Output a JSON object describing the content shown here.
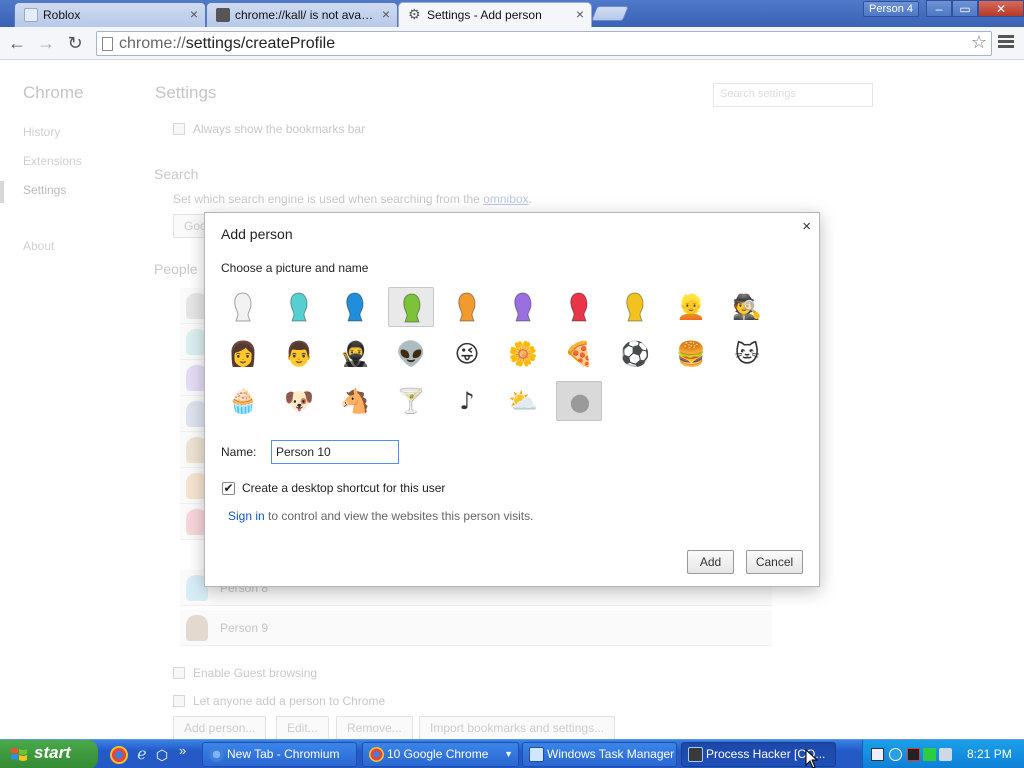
{
  "browser": {
    "tabs": [
      {
        "title": "Roblox",
        "icon": "page-icon",
        "close": "×"
      },
      {
        "title": "chrome://kall/ is not available",
        "icon": "page-icon",
        "close": "×"
      },
      {
        "title": "Settings - Add person",
        "icon": "gear-icon",
        "close": "×"
      }
    ],
    "profile_badge": "Person 4",
    "window_controls": {
      "minimize": "–",
      "maximize": "▭",
      "close": "✕"
    },
    "nav": {
      "back": "←",
      "forward": "→",
      "reload": "↻",
      "star": "☆"
    },
    "omnibox": {
      "scheme": "chrome://",
      "path": "settings/createProfile"
    }
  },
  "settings_page": {
    "nav_title": "Chrome",
    "nav_items": [
      "History",
      "Extensions",
      "Settings",
      "About"
    ],
    "title": "Settings",
    "search_placeholder": "Search settings",
    "bookmarks_bar_label": "Always show the bookmarks bar",
    "search_heading": "Search",
    "search_text": "Set which search engine is used when searching from the",
    "search_link": "omnibox",
    "search_engine_button": "Google",
    "people_heading": "People",
    "people_visible": [
      "Person 8",
      "Person 9"
    ],
    "guest_label": "Enable Guest browsing",
    "anyone_add_label": "Let anyone add a person to Chrome",
    "buttons": [
      "Add person...",
      "Edit...",
      "Remove...",
      "Import bookmarks and settings..."
    ]
  },
  "dialog": {
    "title": "Add person",
    "close": "×",
    "subtitle": "Choose a picture and name",
    "selected_avatar_index": 3,
    "avatars": [
      {
        "name": "white-person-avatar",
        "color": "#f2f2f2"
      },
      {
        "name": "teal-person-avatar",
        "color": "#55d0d0"
      },
      {
        "name": "blue-person-avatar",
        "color": "#1f8fdc"
      },
      {
        "name": "green-person-avatar",
        "color": "#7cc23a"
      },
      {
        "name": "orange-person-avatar",
        "color": "#f29a2e"
      },
      {
        "name": "purple-person-avatar",
        "color": "#9a6fe0"
      },
      {
        "name": "red-person-avatar",
        "color": "#e8354a"
      },
      {
        "name": "yellow-person-avatar",
        "color": "#f2c31e"
      },
      {
        "name": "businessman-avatar",
        "glyph": "👱"
      },
      {
        "name": "ninja-man-avatar",
        "glyph": "🕵"
      },
      {
        "name": "woman-sunglasses-avatar",
        "glyph": "👩"
      },
      {
        "name": "man-avatar",
        "glyph": "👨"
      },
      {
        "name": "ninja-avatar",
        "glyph": "🥷"
      },
      {
        "name": "alien-avatar",
        "glyph": "👽"
      },
      {
        "name": "smiley-avatar",
        "glyph": "😜"
      },
      {
        "name": "flower-avatar",
        "glyph": "🌼"
      },
      {
        "name": "pizza-avatar",
        "glyph": "🍕"
      },
      {
        "name": "soccer-ball-avatar",
        "glyph": "⚽"
      },
      {
        "name": "burger-avatar",
        "glyph": "🍔"
      },
      {
        "name": "cat-avatar",
        "glyph": "🐱"
      },
      {
        "name": "cupcake-avatar",
        "glyph": "🧁"
      },
      {
        "name": "dog-avatar",
        "glyph": "🐶"
      },
      {
        "name": "horse-avatar",
        "glyph": "🐴"
      },
      {
        "name": "cocktail-avatar",
        "glyph": "🍸"
      },
      {
        "name": "music-note-avatar",
        "glyph": "♪"
      },
      {
        "name": "sun-cloud-avatar",
        "glyph": "⛅"
      },
      {
        "name": "generic-silhouette-avatar",
        "glyph": ""
      }
    ],
    "name_label": "Name:",
    "name_value": "Person 10",
    "shortcut_checked": "✔",
    "shortcut_label": "Create a desktop shortcut for this user",
    "signin_link": "Sign in",
    "signin_text": "to control and view the websites this person visits.",
    "add_button": "Add",
    "cancel_button": "Cancel"
  },
  "taskbar": {
    "start_label": "start",
    "more": "»",
    "tasks": [
      {
        "label": "New Tab - Chromium",
        "active": false
      },
      {
        "label": "10 Google Chrome",
        "active": false
      },
      {
        "label": "Windows Task Manager",
        "active": false
      },
      {
        "label": "Process Hacker [CO...",
        "active": true
      }
    ],
    "clock": "8:21 PM"
  }
}
